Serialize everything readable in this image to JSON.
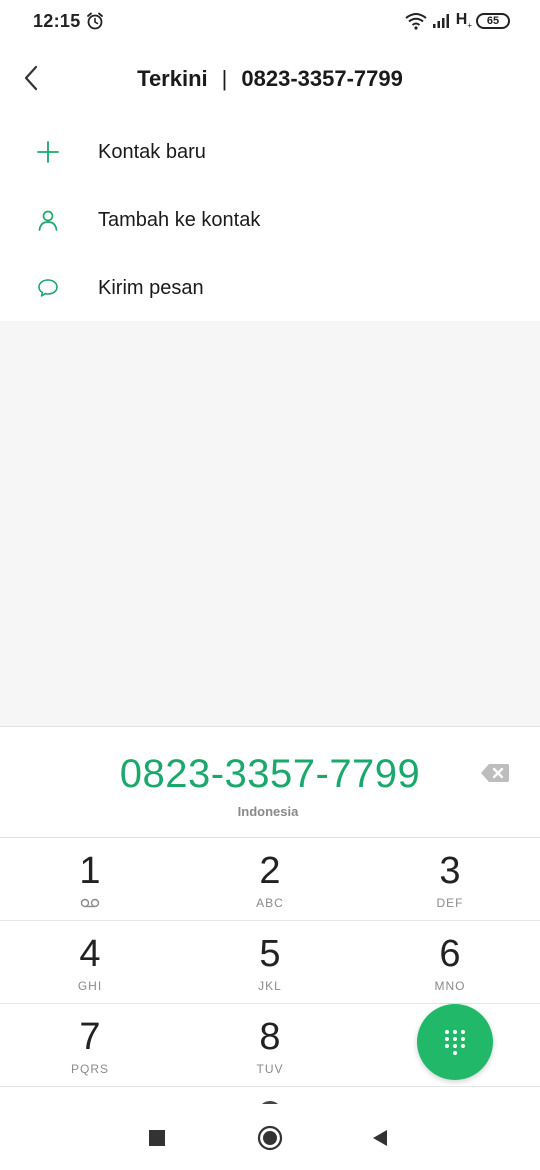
{
  "status_bar": {
    "time": "12:15",
    "network_type": "H",
    "network_sub": "+",
    "battery_level": "65"
  },
  "header": {
    "title_left": "Terkini",
    "separator": "|",
    "title_right": "0823-3357-7799",
    "back_icon": "chevron-left-icon"
  },
  "menu": {
    "items": [
      {
        "label": "Kontak baru",
        "icon": "plus-icon"
      },
      {
        "label": "Tambah ke kontak",
        "icon": "person-icon"
      },
      {
        "label": "Kirim pesan",
        "icon": "message-bubble-icon"
      }
    ]
  },
  "dialer": {
    "number": "0823-3357-7799",
    "country": "Indonesia",
    "backspace_icon": "backspace-icon"
  },
  "keypad": {
    "keys": [
      {
        "digit": "1",
        "letters": ""
      },
      {
        "digit": "2",
        "letters": "ABC"
      },
      {
        "digit": "3",
        "letters": "DEF"
      },
      {
        "digit": "4",
        "letters": "GHI"
      },
      {
        "digit": "5",
        "letters": "JKL"
      },
      {
        "digit": "6",
        "letters": "MNO"
      },
      {
        "digit": "7",
        "letters": "PQRS"
      },
      {
        "digit": "8",
        "letters": "TUV"
      }
    ],
    "fab_icon": "dialpad-icon"
  },
  "colors": {
    "accent": "#1aa86d",
    "fab": "#21b86a"
  }
}
